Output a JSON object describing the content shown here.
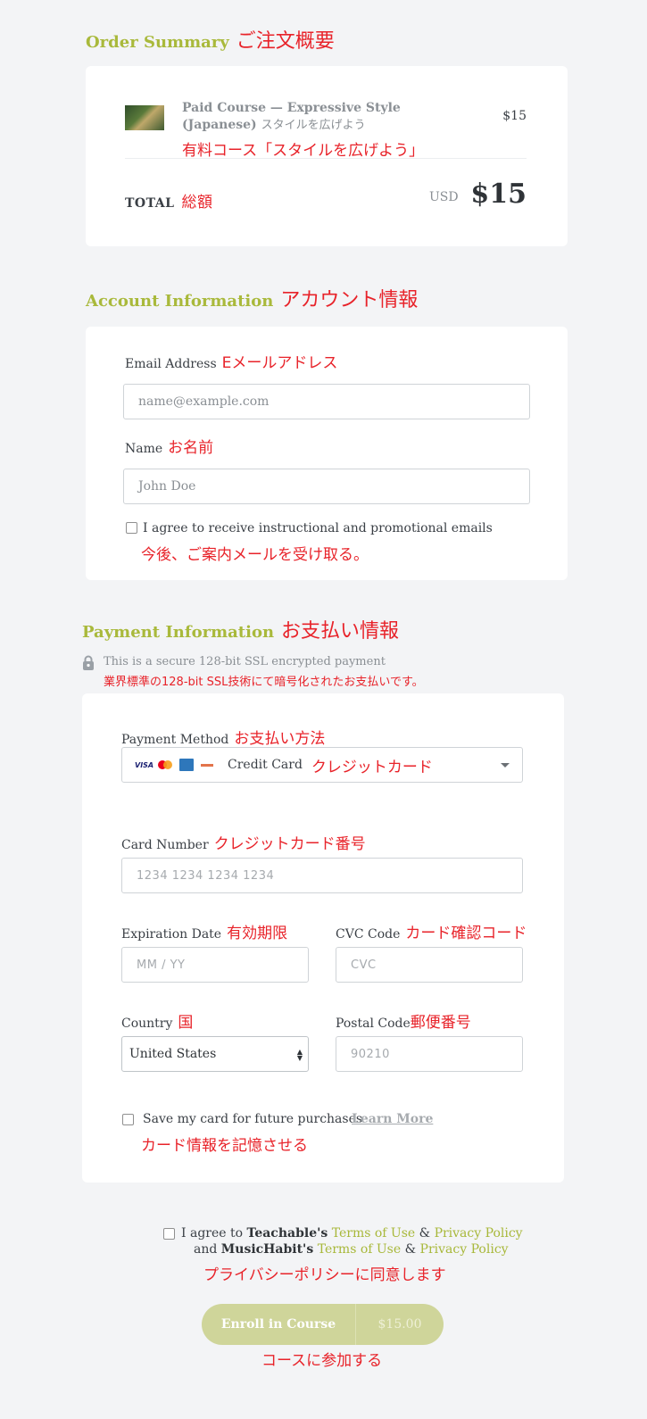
{
  "order_summary": {
    "title": "Order Summary",
    "title_ja": "ご注文概要",
    "item_title_line1": "Paid Course — Expressive Style",
    "item_title_line2": "(Japanese)",
    "item_subtitle": "スタイルを広げよう",
    "item_translation": "有料コース「スタイルを広げよう」",
    "item_price": "$15",
    "total_label": "TOTAL",
    "total_label_ja": "総額",
    "currency": "USD",
    "total_amount": "$15"
  },
  "account_info": {
    "title": "Account Information",
    "title_ja": "アカウント情報",
    "email_label": "Email Address",
    "email_label_ja": "Eメールアドレス",
    "email_placeholder": "name@example.com",
    "name_label": "Name",
    "name_label_ja": "お名前",
    "name_placeholder": "John Doe",
    "consent_text": "I agree to receive instructional and promotional emails",
    "consent_text_ja": "今後、ご案内メールを受け取る。"
  },
  "payment_info": {
    "title": "Payment Information",
    "title_ja": "お支払い情報",
    "secure_note": "This is a secure 128-bit SSL encrypted payment",
    "secure_note_ja": "業界標準の128-bit SSL技術にて暗号化されたお支払いです。",
    "method_label": "Payment Method",
    "method_label_ja": "お支払い方法",
    "method_value": "Credit Card",
    "method_value_ja": "クレジットカード",
    "card_number_label": "Card Number",
    "card_number_label_ja": "クレジットカード番号",
    "card_number_placeholder": "1234 1234 1234 1234",
    "expiry_label": "Expiration Date",
    "expiry_label_ja": "有効期限",
    "expiry_placeholder": "MM / YY",
    "cvc_label": "CVC Code",
    "cvc_label_ja": "カード確認コード",
    "cvc_placeholder": "CVC",
    "country_label": "Country",
    "country_label_ja": "国",
    "country_value": "United States",
    "postal_label": "Postal Code",
    "postal_label_ja": "郵便番号",
    "postal_placeholder": "90210",
    "save_card_text": "Save my card for future purchases",
    "learn_more": "Learn More",
    "save_card_text_ja": "カード情報を記憶させる"
  },
  "terms": {
    "prefix": "I agree to",
    "teachable": "Teachable's",
    "terms_of_use": "Terms of Use",
    "amp": "&",
    "privacy_policy": "Privacy Policy",
    "and": "and",
    "musichabit": "MusicHabit's",
    "terms_ja": "プライバシーポリシーに同意します"
  },
  "enroll": {
    "button_label": "Enroll in Course",
    "button_price": "$15.00",
    "button_ja": "コースに参加する"
  },
  "colors": {
    "accent": "#a9b93b",
    "annotation": "#e8232a",
    "button": "#cfd59a"
  }
}
